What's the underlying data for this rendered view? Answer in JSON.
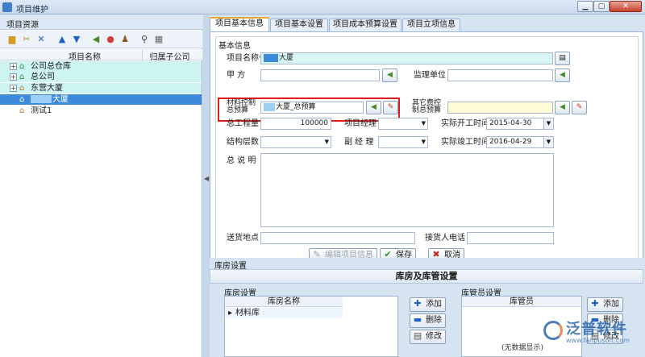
{
  "window": {
    "title": "项目维护",
    "min": "▁",
    "max": "▢",
    "close": "✕"
  },
  "left": {
    "title": "项目资源",
    "toolbar": [
      "folder-icon",
      "cut-icon",
      "delete-icon",
      "up-icon",
      "down-icon",
      "back-icon",
      "color-icon",
      "users-icon",
      "find-icon",
      "grid-icon"
    ],
    "columns": [
      "项目名称",
      "归属子公司"
    ],
    "tree": [
      {
        "label": "公司总仓库",
        "expander": "+"
      },
      {
        "label": "总公司",
        "expander": "+"
      },
      {
        "label": "东营大厦",
        "expander": "+"
      },
      {
        "label": "大厦",
        "expander": ""
      },
      {
        "label": "测试1",
        "expander": ""
      }
    ]
  },
  "tabs": [
    "项目基本信息",
    "项目基本设置",
    "项目成本预算设置",
    "项目立项信息"
  ],
  "basic": {
    "group_title": "基本信息",
    "name_label": "项目名称*",
    "name_value": "大厦",
    "jiafang_label": "甲    方",
    "jiafang_value": "",
    "supervisor_label": "监理单位",
    "supervisor_value": "",
    "material_label_1": "材料控制",
    "material_label_2": "总预算",
    "material_value": "大厦_总预算",
    "other_label_1": "其它费控",
    "other_label_2": "制总预算",
    "other_value": "",
    "quantity_label": "总工程量",
    "quantity_value": "100000",
    "manager_label": "项目经理",
    "manager_value": "",
    "start_label": "实际开工时间",
    "start_value": "2015-04-30",
    "structure_label": "结构层数",
    "structure_value": "",
    "deputy_label": "副 经 理",
    "deputy_value": "",
    "end_label": "实际竣工时间",
    "end_value": "2016-04-29",
    "desc_label": "总 说 明",
    "desc_value": "",
    "delivery_label": "送货地点",
    "delivery_value": "",
    "receiver_label": "接货人电话",
    "receiver_value": "",
    "edit_button": "编辑项目信息",
    "save_button": "保存",
    "cancel_button": "取消"
  },
  "warehouse": {
    "section_title": "库房设置",
    "band_title": "库房及库管设置",
    "left_sub": "库房设置",
    "left_col": "库房名称",
    "left_rows": [
      "材料库"
    ],
    "right_sub": "库管员设置",
    "right_col": "库管员",
    "add": "添加",
    "delete": "删除",
    "modify": "修改"
  },
  "brand": {
    "name": "泛普软件",
    "url": "www.fanpusoft.com",
    "caption": "(无数据显示)"
  },
  "colors": {
    "accent": "#3c8ad8",
    "highlight_row": "#cdf3f3",
    "red_box": "#e11b1b"
  }
}
